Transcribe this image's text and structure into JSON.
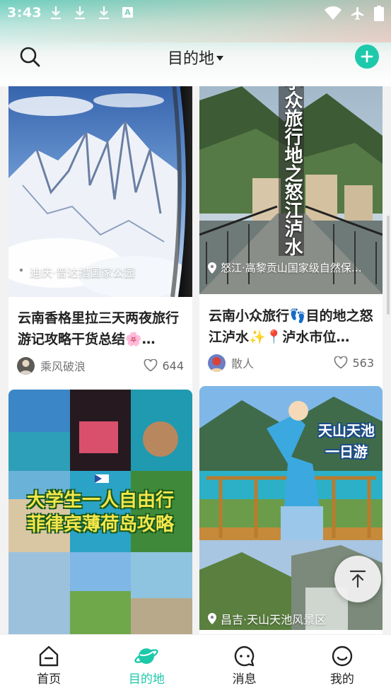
{
  "status": {
    "time": "3:43",
    "badge": "A"
  },
  "appbar": {
    "title": "目的地"
  },
  "cards": [
    {
      "location": "迪庆·普达措国家公园",
      "title": "云南香格里拉三天两夜旅行游记攻略干货总结🌸…",
      "author": "乘风破浪",
      "likes": "644"
    },
    {
      "location": "怒江·高黎贡山国家级自然保…",
      "title": "云南小众旅行👣目的地之怒江泸水✨📍泸水市位…",
      "author": "散人",
      "likes": "563"
    },
    {
      "cover_text": [
        "大学生一人自由行",
        "菲律宾薄荷岛攻略"
      ]
    },
    {
      "location": "昌吉·天山天池风景区",
      "cover_text": [
        "天山天池",
        "一日游"
      ]
    }
  ],
  "card2_vertical_text": "小众旅行地之怒江泸水",
  "nav": [
    {
      "label": "首页",
      "icon": "home-icon"
    },
    {
      "label": "目的地",
      "icon": "planet-icon"
    },
    {
      "label": "消息",
      "icon": "message-icon"
    },
    {
      "label": "我的",
      "icon": "profile-icon"
    }
  ],
  "colors": {
    "accent": "#1ec9ab"
  }
}
